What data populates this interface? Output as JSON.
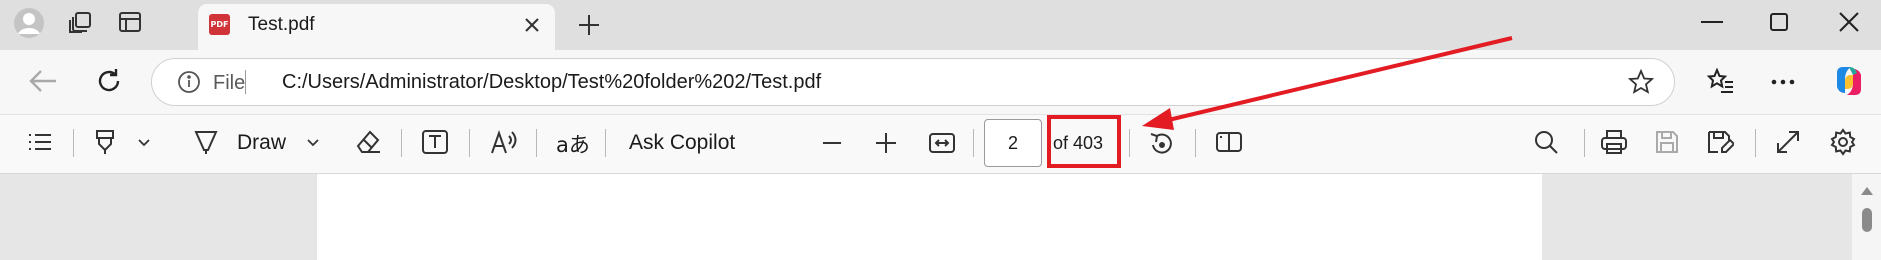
{
  "window": {
    "tab_title": "Test.pdf",
    "tab_icon": "pdf-icon",
    "new_tab_label": "+",
    "controls": [
      "minimize",
      "maximize",
      "close"
    ]
  },
  "address_bar": {
    "info_label": "File",
    "url": "C:/Users/Administrator/Desktop/Test%20folder%202/Test.pdf"
  },
  "pdf_toolbar": {
    "draw_label": "Draw",
    "ask_copilot_label": "Ask Copilot",
    "current_page": "2",
    "total_pages_label": "of 403",
    "read_aloud_glyph": "A",
    "translate_glyph": "aあ"
  },
  "annotation": {
    "color": "#e31b23",
    "target": "total-pages-label"
  },
  "colors": {
    "tab_strip": "#dfdfdf",
    "toolbar": "#f9f9f9",
    "page_background": "#e6e6e6",
    "accent_red": "#e31b23"
  }
}
